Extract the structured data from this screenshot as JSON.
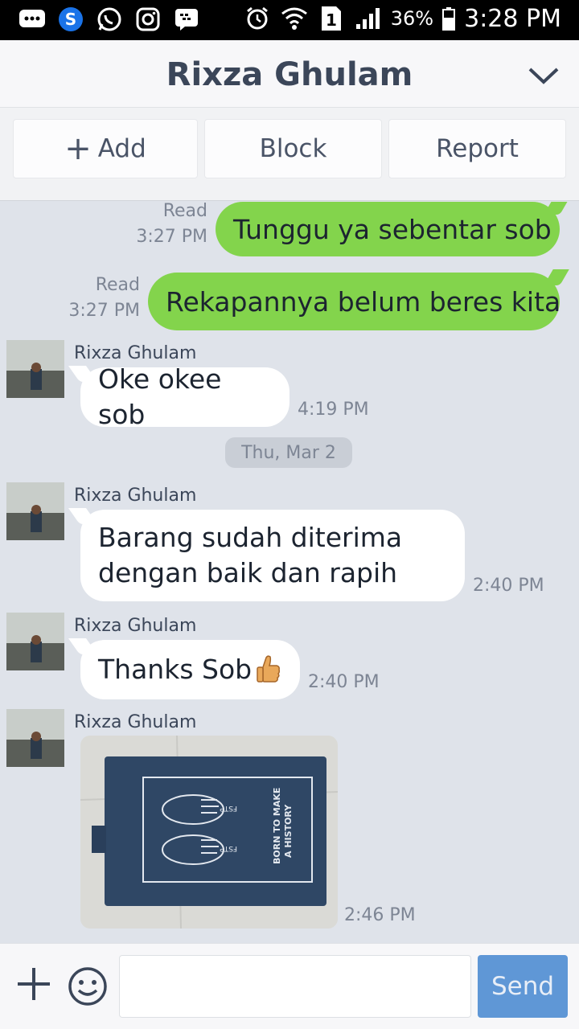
{
  "status_bar": {
    "battery": "36%",
    "time": "3:28 PM",
    "sim": "1"
  },
  "header": {
    "title": "Rixza Ghulam"
  },
  "actions": {
    "add_label": "Add",
    "block_label": "Block",
    "report_label": "Report"
  },
  "messages": [
    {
      "type": "out",
      "text": "Tunggu ya sebentar sob",
      "status": "Read",
      "time": "3:27 PM"
    },
    {
      "type": "out",
      "text": "Rekapannya belum beres kita",
      "status": "Read",
      "time": "3:27 PM"
    },
    {
      "type": "in",
      "sender": "Rixza Ghulam",
      "text": "Oke okee sob",
      "time": "4:19 PM"
    },
    {
      "type": "date",
      "text": "Thu, Mar 2"
    },
    {
      "type": "in",
      "sender": "Rixza Ghulam",
      "text_line1": "Barang sudah diterima",
      "text_line2": "dengan baik dan rapih",
      "time": "2:40 PM"
    },
    {
      "type": "in",
      "sender": "Rixza Ghulam",
      "text": "Thanks Sob",
      "time": "2:40 PM"
    },
    {
      "type": "in_image",
      "sender": "Rixza Ghulam",
      "image_text1": "BORN TO MAKE",
      "image_text2": "A HISTORY",
      "image_label": "FSTP",
      "time": "2:46 PM"
    }
  ],
  "input": {
    "value": "",
    "send_label": "Send"
  },
  "colors": {
    "outgoing_bubble": "#83d44c",
    "incoming_bubble": "#ffffff",
    "chat_background": "#dfe3ea",
    "send_button": "#5f97d6"
  }
}
